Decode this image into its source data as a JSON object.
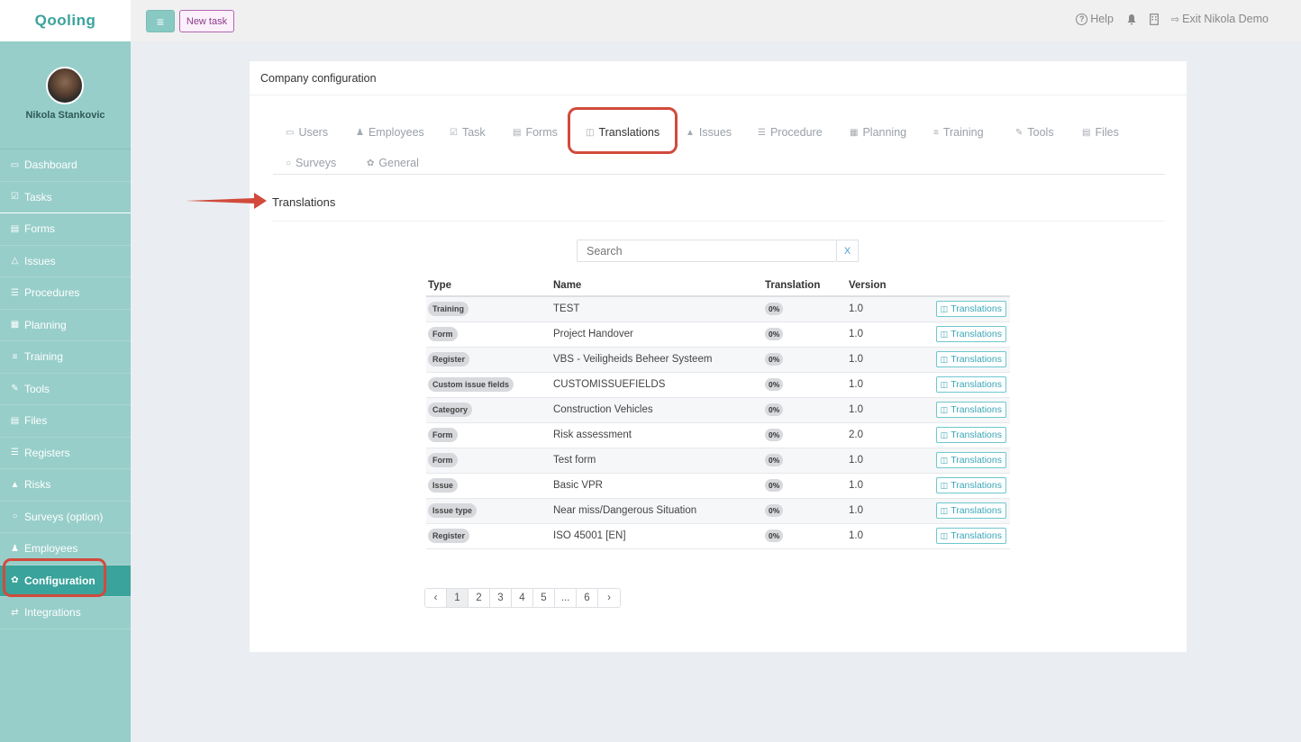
{
  "topbar": {
    "logo": "Qooling",
    "menu_icon": "hamburger-icon",
    "new_task": "New task",
    "help": "Help",
    "exit": "Exit Nikola Demo"
  },
  "sidebar": {
    "user_name": "Nikola Stankovic",
    "items": [
      {
        "label": "Dashboard",
        "icon": "monitor-icon",
        "glyph": "▭"
      },
      {
        "label": "Tasks",
        "icon": "check-square-icon",
        "glyph": "☑"
      },
      {
        "label": "Forms",
        "icon": "file-icon",
        "glyph": "▤"
      },
      {
        "label": "Issues",
        "icon": "bell-icon",
        "glyph": "△"
      },
      {
        "label": "Procedures",
        "icon": "list-icon",
        "glyph": "☰"
      },
      {
        "label": "Planning",
        "icon": "calendar-icon",
        "glyph": "▦"
      },
      {
        "label": "Training",
        "icon": "graduation-cap-icon",
        "glyph": "≡"
      },
      {
        "label": "Tools",
        "icon": "wrench-icon",
        "glyph": "✎"
      },
      {
        "label": "Files",
        "icon": "file-icon",
        "glyph": "▤"
      },
      {
        "label": "Registers",
        "icon": "list-icon",
        "glyph": "☰"
      },
      {
        "label": "Risks",
        "icon": "warning-icon",
        "glyph": "▲"
      },
      {
        "label": "Surveys (option)",
        "icon": "chat-icon",
        "glyph": "○"
      },
      {
        "label": "Employees",
        "icon": "users-icon",
        "glyph": "♟"
      },
      {
        "label": "Configuration",
        "icon": "gear-icon",
        "glyph": "✿"
      },
      {
        "label": "Integrations",
        "icon": "exchange-icon",
        "glyph": "⇄"
      }
    ]
  },
  "main": {
    "header": "Company configuration",
    "tabs": [
      {
        "label": "Users",
        "icon": "id-card-icon",
        "glyph": "▭"
      },
      {
        "label": "Employees",
        "icon": "users-icon",
        "glyph": "♟"
      },
      {
        "label": "Task",
        "icon": "check-square-icon",
        "glyph": "☑"
      },
      {
        "label": "Forms",
        "icon": "file-icon",
        "glyph": "▤"
      },
      {
        "label": "Translations",
        "icon": "language-icon",
        "glyph": "◫"
      },
      {
        "label": "Issues",
        "icon": "bell-icon",
        "glyph": "▲"
      },
      {
        "label": "Procedure",
        "icon": "list-icon",
        "glyph": "☰"
      },
      {
        "label": "Planning",
        "icon": "calendar-icon",
        "glyph": "▦"
      },
      {
        "label": "Training",
        "icon": "graduation-cap-icon",
        "glyph": "≡"
      },
      {
        "label": "Tools",
        "icon": "wrench-icon",
        "glyph": "✎"
      },
      {
        "label": "Files",
        "icon": "file-icon",
        "glyph": "▤"
      },
      {
        "label": "Surveys",
        "icon": "chat-icon",
        "glyph": "○"
      },
      {
        "label": "General",
        "icon": "gear-icon",
        "glyph": "✿"
      }
    ],
    "section_title": "Translations",
    "search": {
      "placeholder": "Search",
      "clear": "X"
    },
    "table": {
      "headers": [
        "Type",
        "Name",
        "Translation",
        "Version",
        ""
      ],
      "rows": [
        {
          "type": "Training",
          "name": "TEST",
          "translation": "0%",
          "version": "1.0",
          "action": "Translations"
        },
        {
          "type": "Form",
          "name": "Project Handover",
          "translation": "0%",
          "version": "1.0",
          "action": "Translations"
        },
        {
          "type": "Register",
          "name": "VBS - Veiligheids Beheer Systeem",
          "translation": "0%",
          "version": "1.0",
          "action": "Translations"
        },
        {
          "type": "Custom issue fields",
          "name": "CUSTOMISSUEFIELDS",
          "translation": "0%",
          "version": "1.0",
          "action": "Translations"
        },
        {
          "type": "Category",
          "name": "Construction Vehicles",
          "translation": "0%",
          "version": "1.0",
          "action": "Translations"
        },
        {
          "type": "Form",
          "name": "Risk assessment",
          "translation": "0%",
          "version": "2.0",
          "action": "Translations"
        },
        {
          "type": "Form",
          "name": "Test form",
          "translation": "0%",
          "version": "1.0",
          "action": "Translations"
        },
        {
          "type": "Issue",
          "name": "Basic VPR",
          "translation": "0%",
          "version": "1.0",
          "action": "Translations"
        },
        {
          "type": "Issue type",
          "name": "Near miss/Dangerous Situation",
          "translation": "0%",
          "version": "1.0",
          "action": "Translations"
        },
        {
          "type": "Register",
          "name": "ISO 45001 [EN]",
          "translation": "0%",
          "version": "1.0",
          "action": "Translations"
        }
      ]
    },
    "pagination": [
      "‹",
      "1",
      "2",
      "3",
      "4",
      "5",
      "...",
      "6",
      "›"
    ]
  }
}
